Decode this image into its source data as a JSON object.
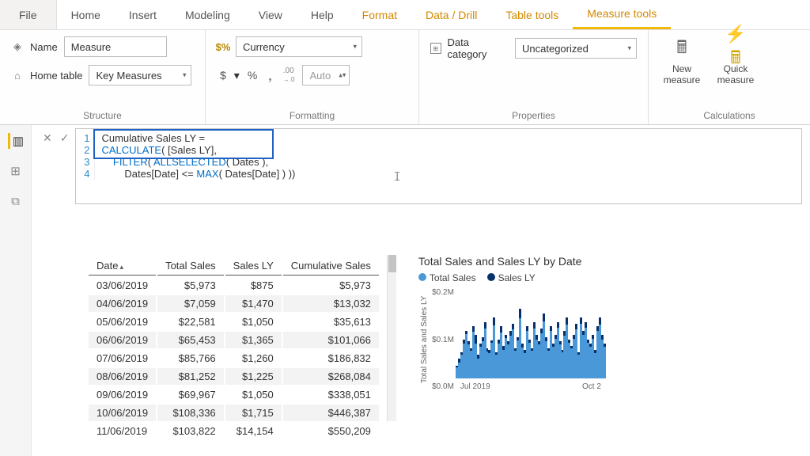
{
  "menu": {
    "file": "File",
    "items": [
      "Home",
      "Insert",
      "Modeling",
      "View",
      "Help",
      "Format",
      "Data / Drill",
      "Table tools",
      "Measure tools"
    ],
    "yellow_from_index": 5,
    "active_index": 8
  },
  "ribbon": {
    "structure": {
      "name_label": "Name",
      "name_value": "Measure",
      "home_table_label": "Home table",
      "home_table_value": "Key Measures",
      "group_label": "Structure"
    },
    "formatting": {
      "currency_value": "Currency",
      "auto_value": "Auto",
      "dollar": "$",
      "percent": "%",
      "comma": ",",
      "decimals_icon": ".00→.0",
      "group_label": "Formatting"
    },
    "properties": {
      "data_category_label": "Data category",
      "data_category_value": "Uncategorized",
      "group_label": "Properties"
    },
    "calculations": {
      "new_measure": "New measure",
      "quick_measure": "Quick measure",
      "group_label": "Calculations"
    }
  },
  "formula": {
    "lines": [
      {
        "n": "1",
        "text": "Cumulative Sales LY ="
      },
      {
        "n": "2",
        "text": "CALCULATE( [Sales LY],"
      },
      {
        "n": "3",
        "text": "    FILTER( ALLSELECTED( Dates ),"
      },
      {
        "n": "4",
        "text": "        Dates[Date] <= MAX( Dates[Date] ) ))"
      }
    ]
  },
  "table": {
    "columns": [
      "Date",
      "Total Sales",
      "Sales LY",
      "Cumulative Sales"
    ],
    "rows": [
      [
        "03/06/2019",
        "$5,973",
        "$875",
        "$5,973"
      ],
      [
        "04/06/2019",
        "$7,059",
        "$1,470",
        "$13,032"
      ],
      [
        "05/06/2019",
        "$22,581",
        "$1,050",
        "$35,613"
      ],
      [
        "06/06/2019",
        "$65,453",
        "$1,365",
        "$101,066"
      ],
      [
        "07/06/2019",
        "$85,766",
        "$1,260",
        "$186,832"
      ],
      [
        "08/06/2019",
        "$81,252",
        "$1,225",
        "$268,084"
      ],
      [
        "09/06/2019",
        "$69,967",
        "$1,050",
        "$338,051"
      ],
      [
        "10/06/2019",
        "$108,336",
        "$1,715",
        "$446,387"
      ],
      [
        "11/06/2019",
        "$103,822",
        "$14,154",
        "$550,209"
      ]
    ]
  },
  "chart_data": {
    "type": "bar",
    "title": "Total Sales and Sales LY by Date",
    "ylabel": "Total Sales and Sales LY",
    "ylim": [
      0,
      200000
    ],
    "y_ticks": [
      "$0.2M",
      "$0.1M",
      "$0.0M"
    ],
    "x_ticks": [
      "Jul 2019",
      "Oct 2"
    ],
    "series": [
      {
        "name": "Total Sales",
        "color": "#4a98d8"
      },
      {
        "name": "Sales LY",
        "color": "#08306b"
      }
    ],
    "preview_values": {
      "total_sales": [
        30,
        45,
        60,
        90,
        110,
        85,
        70,
        120,
        100,
        55,
        80,
        95,
        130,
        70,
        65,
        88,
        140,
        60,
        90,
        120,
        75,
        100,
        85,
        110,
        125,
        70,
        95,
        160,
        80,
        65,
        120,
        90,
        70,
        130,
        100,
        85,
        115,
        150,
        95,
        70,
        120,
        80,
        100,
        130,
        85,
        65,
        110,
        140,
        90,
        75,
        100,
        125,
        60,
        140,
        110,
        130,
        90,
        80,
        100,
        65,
        120,
        140,
        100,
        80
      ],
      "sales_ly": [
        5,
        8,
        6,
        10,
        9,
        7,
        6,
        12,
        20,
        10,
        8,
        9,
        15,
        8,
        6,
        7,
        18,
        6,
        10,
        14,
        9,
        8,
        7,
        11,
        13,
        6,
        8,
        22,
        9,
        7,
        10,
        8,
        6,
        16,
        10,
        7,
        12,
        19,
        9,
        6,
        10,
        8,
        9,
        14,
        7,
        5,
        11,
        17,
        8,
        6,
        9,
        13,
        6,
        15,
        10,
        14,
        8,
        7,
        9,
        6,
        11,
        16,
        10,
        7
      ]
    }
  }
}
